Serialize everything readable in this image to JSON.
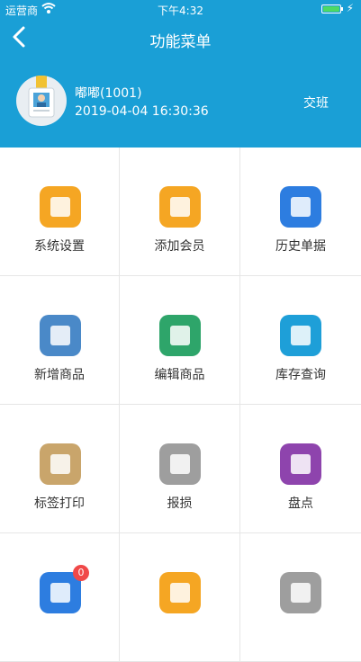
{
  "status_bar": {
    "carrier": "运营商",
    "time": "下午4:32"
  },
  "nav": {
    "title": "功能菜单"
  },
  "user": {
    "name": "嘟嘟(1001)",
    "datetime": "2019-04-04 16:30:36",
    "shift_label": "交班"
  },
  "menu": [
    {
      "label": "系统设置",
      "icon": "gears-icon",
      "color": "#f5a623"
    },
    {
      "label": "添加会员",
      "icon": "vip-icon",
      "color": "#f5a623"
    },
    {
      "label": "历史单据",
      "icon": "documents-clock-icon",
      "color": "#2d7de0"
    },
    {
      "label": "新增商品",
      "icon": "add-product-icon",
      "color": "#4a89c8"
    },
    {
      "label": "编辑商品",
      "icon": "edit-product-icon",
      "color": "#2ea56a"
    },
    {
      "label": "库存查询",
      "icon": "stock-search-icon",
      "color": "#1e9fd8"
    },
    {
      "label": "标签打印",
      "icon": "label-print-icon",
      "color": "#c9a56b"
    },
    {
      "label": "报损",
      "icon": "broken-egg-icon",
      "color": "#9e9e9e"
    },
    {
      "label": "盘点",
      "icon": "clipboard-check-icon",
      "color": "#8e44ad"
    },
    {
      "label": "",
      "icon": "mailbox-icon",
      "color": "#2d7de0",
      "badge": "0"
    },
    {
      "label": "",
      "icon": "clipboard-alert-icon",
      "color": "#f5a623"
    },
    {
      "label": "",
      "icon": "box-icon",
      "color": "#9e9e9e"
    }
  ]
}
